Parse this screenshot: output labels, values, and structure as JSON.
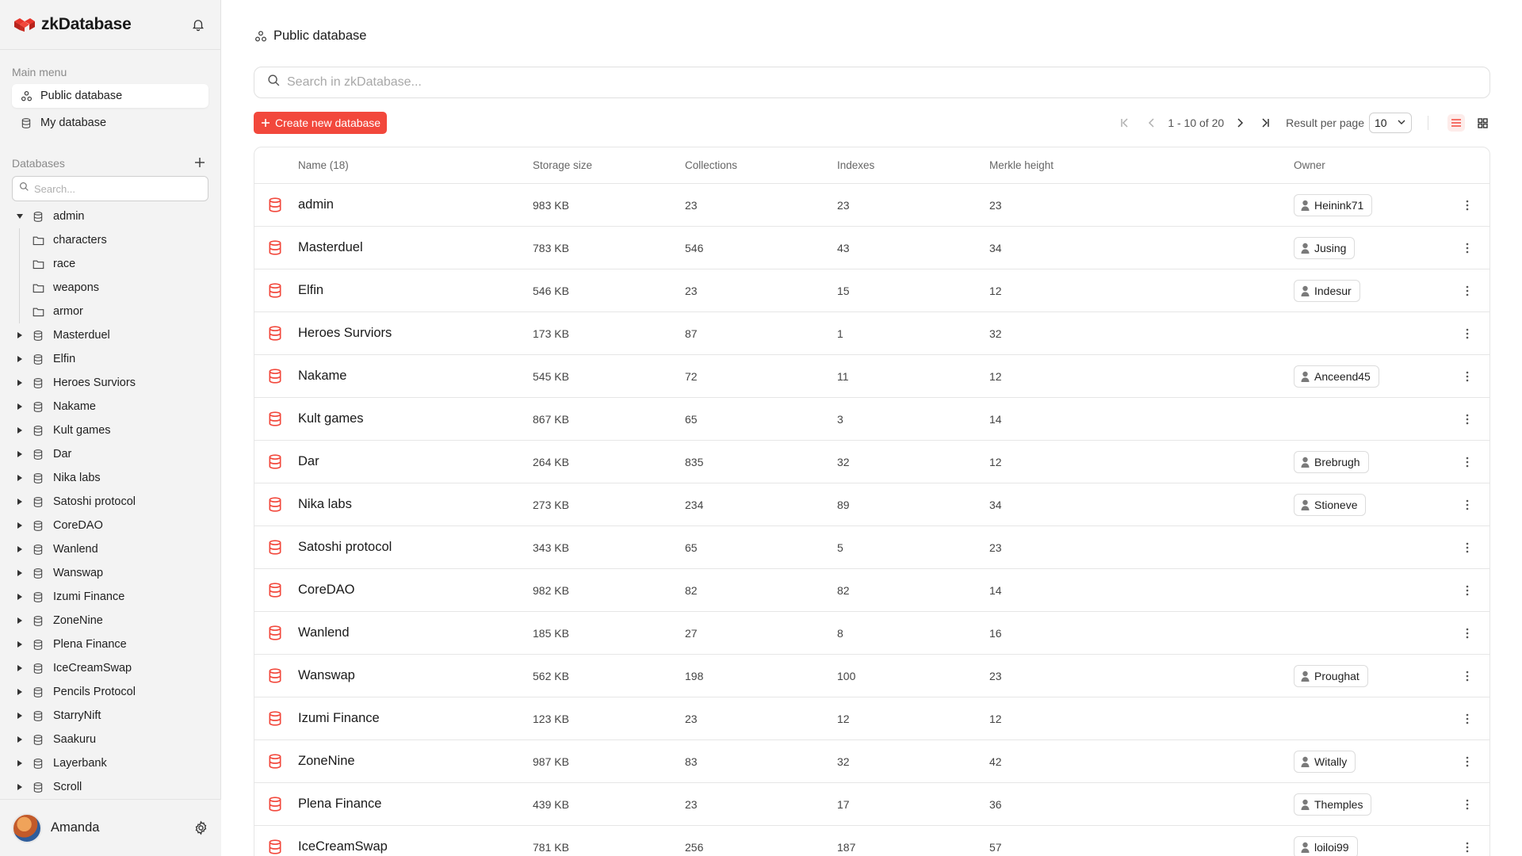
{
  "app": {
    "name": "zkDatabase"
  },
  "sidebar": {
    "main_menu_label": "Main menu",
    "menu": [
      {
        "label": "Public database",
        "icon": "public-db-icon",
        "active": true
      },
      {
        "label": "My database",
        "icon": "database-icon",
        "active": false
      }
    ],
    "databases_label": "Databases",
    "search_placeholder": "Search...",
    "tree": [
      {
        "label": "admin",
        "expanded": true,
        "children": [
          "characters",
          "race",
          "weapons",
          "armor"
        ]
      },
      {
        "label": "Masterduel"
      },
      {
        "label": "Elfin"
      },
      {
        "label": "Heroes Surviors"
      },
      {
        "label": "Nakame"
      },
      {
        "label": "Kult games"
      },
      {
        "label": "Dar"
      },
      {
        "label": "Nika labs"
      },
      {
        "label": "Satoshi protocol"
      },
      {
        "label": "CoreDAO"
      },
      {
        "label": "Wanlend"
      },
      {
        "label": "Wanswap"
      },
      {
        "label": "Izumi Finance"
      },
      {
        "label": "ZoneNine"
      },
      {
        "label": "Plena Finance"
      },
      {
        "label": "IceCreamSwap"
      },
      {
        "label": "Pencils Protocol"
      },
      {
        "label": "StarryNift"
      },
      {
        "label": "Saakuru"
      },
      {
        "label": "Layerbank"
      },
      {
        "label": "Scroll"
      }
    ],
    "user": {
      "name": "Amanda"
    }
  },
  "main": {
    "title": "Public database",
    "search_placeholder": "Search in zkDatabase...",
    "create_button": "Create new database",
    "pager": {
      "range": "1 - 10 of 20",
      "rpp_label": "Result per page",
      "rpp_value": "10"
    },
    "table": {
      "headers": {
        "name": "Name (18)",
        "size": "Storage size",
        "collections": "Collections",
        "indexes": "Indexes",
        "merkle": "Merkle height",
        "owner": "Owner"
      },
      "rows": [
        {
          "name": "admin",
          "size": "983 KB",
          "collections": "23",
          "indexes": "23",
          "merkle": "23",
          "owner": "Heinink71"
        },
        {
          "name": "Masterduel",
          "size": "783 KB",
          "collections": "546",
          "indexes": "43",
          "merkle": "34",
          "owner": "Jusing"
        },
        {
          "name": "Elfin",
          "size": "546 KB",
          "collections": "23",
          "indexes": "15",
          "merkle": "12",
          "owner": "Indesur"
        },
        {
          "name": "Heroes Surviors",
          "size": "173 KB",
          "collections": "87",
          "indexes": "1",
          "merkle": "32",
          "owner": ""
        },
        {
          "name": "Nakame",
          "size": "545 KB",
          "collections": "72",
          "indexes": "11",
          "merkle": "12",
          "owner": "Anceend45"
        },
        {
          "name": "Kult games",
          "size": "867 KB",
          "collections": "65",
          "indexes": "3",
          "merkle": "14",
          "owner": ""
        },
        {
          "name": "Dar",
          "size": "264 KB",
          "collections": "835",
          "indexes": "32",
          "merkle": "12",
          "owner": "Brebrugh"
        },
        {
          "name": "Nika labs",
          "size": "273 KB",
          "collections": "234",
          "indexes": "89",
          "merkle": "34",
          "owner": "Stioneve"
        },
        {
          "name": "Satoshi protocol",
          "size": "343 KB",
          "collections": "65",
          "indexes": "5",
          "merkle": "23",
          "owner": ""
        },
        {
          "name": "CoreDAO",
          "size": "982 KB",
          "collections": "82",
          "indexes": "82",
          "merkle": "14",
          "owner": ""
        },
        {
          "name": "Wanlend",
          "size": "185 KB",
          "collections": "27",
          "indexes": "8",
          "merkle": "16",
          "owner": ""
        },
        {
          "name": "Wanswap",
          "size": "562 KB",
          "collections": "198",
          "indexes": "100",
          "merkle": "23",
          "owner": "Proughat"
        },
        {
          "name": "Izumi Finance",
          "size": "123 KB",
          "collections": "23",
          "indexes": "12",
          "merkle": "12",
          "owner": ""
        },
        {
          "name": "ZoneNine",
          "size": "987 KB",
          "collections": "83",
          "indexes": "32",
          "merkle": "42",
          "owner": "Witally"
        },
        {
          "name": "Plena Finance",
          "size": "439 KB",
          "collections": "23",
          "indexes": "17",
          "merkle": "36",
          "owner": "Themples"
        },
        {
          "name": "IceCreamSwap",
          "size": "781 KB",
          "collections": "256",
          "indexes": "187",
          "merkle": "57",
          "owner": "loiloi99"
        }
      ]
    }
  },
  "colors": {
    "accent": "#f2483c",
    "sidebar_bg": "#f3f3f3",
    "border": "#e6e6e6"
  },
  "icons": {
    "brand": "zkdatabase-logo",
    "bell": "bell-icon",
    "folder": "folder-icon",
    "database": "database-icon",
    "caret_right": "caret-right-icon",
    "caret_down": "caret-down-icon",
    "user": "user-icon",
    "settings": "gear-icon",
    "more": "more-vertical-icon",
    "list_view": "list-view-icon",
    "grid_view": "grid-view-icon"
  }
}
